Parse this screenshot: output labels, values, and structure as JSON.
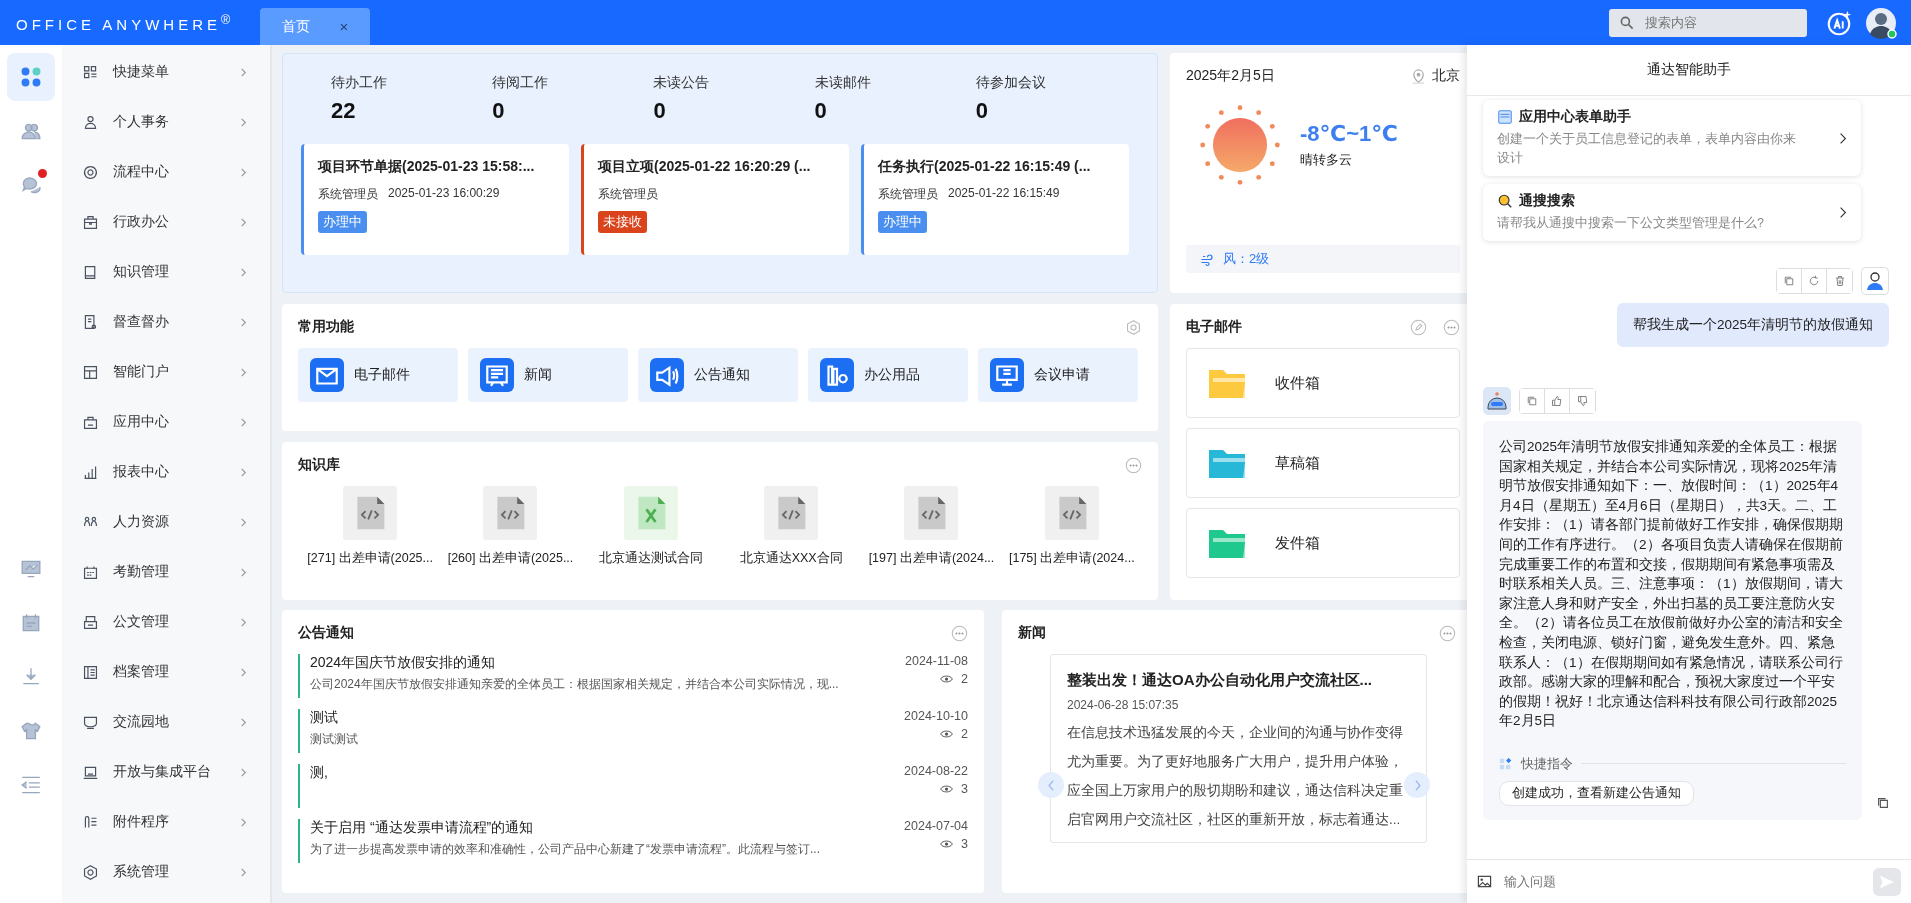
{
  "header": {
    "logo": "OFFICE ANYWHERE$^{®}$",
    "tabs": [
      {
        "label": "首页",
        "close": "×",
        "selected": true
      }
    ],
    "search": {
      "placeholder": "搜索内容"
    }
  },
  "rail": [
    {
      "kind": "apps",
      "selected": true,
      "badge": false
    },
    {
      "kind": "contacts",
      "selected": false,
      "badge": false
    },
    {
      "kind": "chat",
      "selected": false,
      "badge": true
    },
    {
      "kind": "chart",
      "selected": false,
      "badge": false
    },
    {
      "kind": "clipboard",
      "selected": false,
      "badge": false
    },
    {
      "kind": "download",
      "selected": false,
      "badge": false
    },
    {
      "kind": "shirt",
      "selected": false,
      "badge": false
    },
    {
      "kind": "collapse",
      "selected": false,
      "badge": false
    }
  ],
  "menu": [
    "快捷菜单",
    "个人事务",
    "流程中心",
    "行政办公",
    "知识管理",
    "督查督办",
    "智能门户",
    "应用中心",
    "报表中心",
    "人力资源",
    "考勤管理",
    "公文管理",
    "档案管理",
    "交流园地",
    "开放与集成平台",
    "附件程序",
    "系统管理"
  ],
  "stats": [
    {
      "label": "待办工作",
      "value": "22"
    },
    {
      "label": "待阅工作",
      "value": "0"
    },
    {
      "label": "未读公告",
      "value": "0"
    },
    {
      "label": "未读邮件",
      "value": "0"
    },
    {
      "label": "待参加会议",
      "value": "0"
    }
  ],
  "tasks": [
    {
      "title": "项目环节单据(2025-01-23 15:58:...",
      "person": "系统管理员",
      "time": "2025-01-23 16:00:29",
      "status": "办理中",
      "color": "#4a8ff0"
    },
    {
      "title": "项目立项(2025-01-22 16:20:29 (...",
      "person": "系统管理员",
      "status": "未接收",
      "color": "#d9441c"
    },
    {
      "title": "任务执行(2025-01-22 16:15:49 (...",
      "person": "系统管理员",
      "time": "2025-01-22 16:15:49",
      "status": "办理中",
      "color": "#4a8ff0"
    }
  ],
  "weather": {
    "date": "2025年2月5日",
    "city": "北京",
    "temp": "-8℃~1℃",
    "desc": "晴转多云",
    "wind": "风：2级"
  },
  "functions": {
    "title": "常用功能",
    "items": [
      "电子邮件",
      "新闻",
      "公告通知",
      "办公用品",
      "会议申请"
    ]
  },
  "knowledge": {
    "title": "知识库",
    "items": [
      {
        "label": "[271] 出差申请(2025...",
        "kind": "code"
      },
      {
        "label": "[260] 出差申请(2025...",
        "kind": "code"
      },
      {
        "label": "北京通达测试合同",
        "kind": "excel"
      },
      {
        "label": "北京通达XXX合同",
        "kind": "code"
      },
      {
        "label": "[197] 出差申请(2024...",
        "kind": "code"
      },
      {
        "label": "[175] 出差申请(2024...",
        "kind": "code"
      }
    ]
  },
  "email": {
    "title": "电子邮件",
    "folders": [
      {
        "label": "收件箱",
        "color": "#fcc93f"
      },
      {
        "label": "草稿箱",
        "color": "#27b8d8"
      },
      {
        "label": "发件箱",
        "color": "#1fc98e"
      }
    ]
  },
  "notices": {
    "title": "公告通知",
    "items": [
      {
        "title": "2024年国庆节放假安排的通知",
        "summary": "公司2024年国庆节放假安排通知亲爱的全体员工：根据国家相关规定，并结合本公司实际情况，现...",
        "date": "2024-11-08",
        "views": "2"
      },
      {
        "title": "测试",
        "summary": "测试测试",
        "date": "2024-10-10",
        "views": "2"
      },
      {
        "title": "测,",
        "date": "2024-08-22",
        "views": "3"
      },
      {
        "title": "关于启用 “通达发票申请流程”的通知",
        "summary": "为了进一步提高发票申请的效率和准确性，公司产品中心新建了“发票申请流程”。此流程与签订...",
        "date": "2024-07-04",
        "views": "3"
      }
    ]
  },
  "news": {
    "title": "新闻",
    "headline": "整装出发！通达OA办公自动化用户交流社区...",
    "time": "2024-06-28 15:07:35",
    "body": "在信息技术迅猛发展的今天，企业间的沟通与协作变得尤为重要。为了更好地服务广大用户，提升用户体验，应全国上万家用户的殷切期盼和建议，通达信科决定重启官网用户交流社区，社区的重新开放，标志着通达..."
  },
  "assistant": {
    "title": "通达智能助手",
    "cards": [
      {
        "title": "应用中心表单助手",
        "text": "创建一个关于员工信息登记的表单，表单内容由你来设计"
      },
      {
        "title": "通搜搜索",
        "text": "请帮我从通搜中搜索一下公文类型管理是什么?"
      }
    ],
    "user_message": "帮我生成一个2025年清明节的放假通知",
    "reply": "公司2025年清明节放假安排通知亲爱的全体员工：根据国家相关规定，并结合本公司实际情况，现将2025年清明节放假安排通知如下：一、放假时间：（1）2025年4月4日（星期五）至4月6日（星期日），共3天。二、工作安排：（1）请各部门提前做好工作安排，确保假期期间的工作有序进行。（2）各项目负责人请确保在假期前完成重要工作的布置和交接，假期期间有紧急事项需及时联系相关人员。三、注意事项：（1）放假期间，请大家注意人身和财产安全，外出扫墓的员工要注意防火安全。（2）请各位员工在放假前做好办公室的清洁和安全检查，关闭电源、锁好门窗，避免发生意外。四、紧急联系人：（1）在假期期间如有紧急情况，请联系公司行政部。感谢大家的理解和配合，预祝大家度过一个平安的假期！祝好！北京通达信科科技有限公司行政部2025年2月5日",
    "quick_label": "快捷指令",
    "quick_chip": "创建成功，查看新建公告通知",
    "input": {
      "placeholder": "输入问题"
    }
  }
}
